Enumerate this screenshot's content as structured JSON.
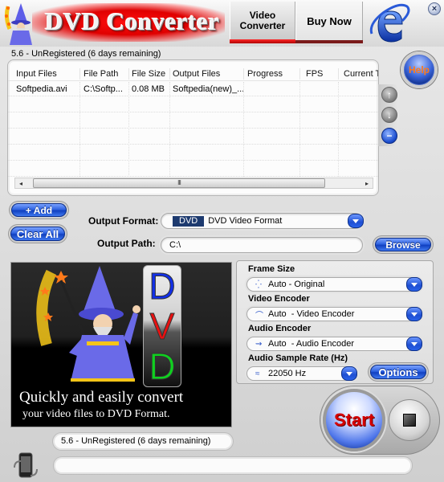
{
  "header": {
    "app_title": "DVD Converter",
    "tabs": [
      {
        "label_line1": "Video",
        "label_line2": "Converter",
        "active": true
      },
      {
        "label": "Buy Now",
        "active": false
      }
    ],
    "close_symbol": "×"
  },
  "status_top": "5.6 - UnRegistered (6 days remaining)",
  "file_list": {
    "columns": [
      "Input Files",
      "File Path",
      "File Size",
      "Output Files",
      "Progress",
      "FPS",
      "Current T"
    ],
    "rows": [
      {
        "input": "Softpedia.avi",
        "path": "C:\\Softp...",
        "size": "0.08 MB",
        "output": "Softpedia(new)_...",
        "progress": "",
        "fps": "",
        "current": ""
      }
    ],
    "scroll_thumb_glyph": "III",
    "scroll_left_glyph": "◂",
    "scroll_right_glyph": "▸"
  },
  "side_buttons": {
    "up_glyph": "↑",
    "down_glyph": "↓",
    "remove_glyph": "−",
    "help_label": "Help"
  },
  "buttons": {
    "add": "+ Add",
    "clear_all": "Clear All",
    "browse": "Browse",
    "options": "Options",
    "start": "Start"
  },
  "output": {
    "format_label": "Output Format:",
    "format_chip": "DVD",
    "format_value": "DVD Video Format",
    "path_label": "Output Path:",
    "path_value": "C:\\"
  },
  "promo": {
    "letters": [
      "D",
      "V",
      "D"
    ],
    "letter_colors": [
      "#1230e8",
      "#e81010",
      "#10d020"
    ],
    "line1": "Quickly and easily convert",
    "line2": "your video files to DVD Format."
  },
  "settings": {
    "frame_size_label": "Frame Size",
    "frame_size_value": "Auto - Original",
    "video_encoder_label": "Video Encoder",
    "video_encoder_value": "Auto  - Video Encoder",
    "audio_encoder_label": "Audio Encoder",
    "audio_encoder_value": "Auto  - Audio Encoder",
    "sample_rate_label": "Audio Sample Rate (Hz)",
    "sample_rate_value": "22050 Hz"
  },
  "status_bottom": "5.6 - UnRegistered (6 days remaining)",
  "progress": {
    "value": 0
  },
  "colors": {
    "accent_blue": "#2f63e0",
    "brand_red": "#e00000",
    "help_text": "#ff7a1a"
  }
}
